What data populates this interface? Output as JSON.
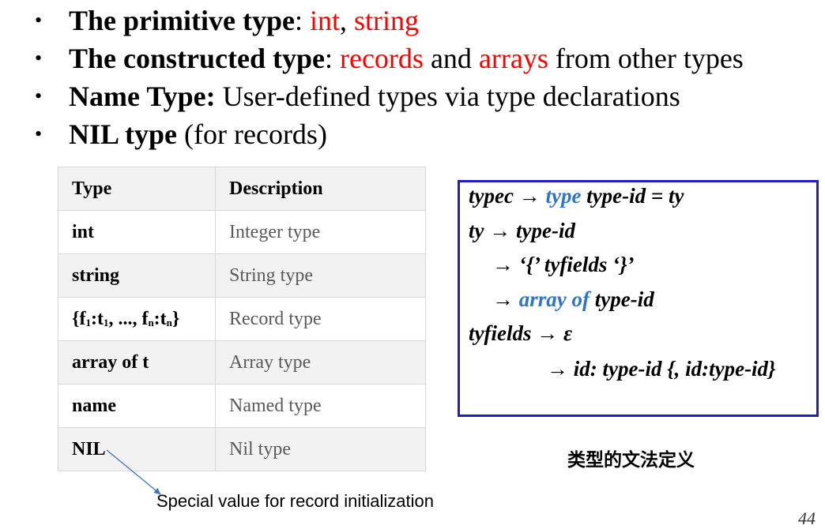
{
  "bullets": [
    {
      "bold": "The primitive type",
      "sep": ": ",
      "red1": "int",
      "mid": ", ",
      "red2": "string",
      "rest": ""
    },
    {
      "bold": "The constructed type",
      "sep": ": ",
      "red1": "records",
      "mid": " and ",
      "red2": "arrays",
      "rest": " from other types"
    },
    {
      "bold": "Name Type:",
      "rest": " User-defined types via type declarations"
    },
    {
      "bold": "NIL type",
      "rest": " (for records)"
    }
  ],
  "table": {
    "headers": [
      "Type",
      "Description"
    ],
    "rows": [
      {
        "type": "int",
        "desc": "Integer type"
      },
      {
        "type": "string",
        "desc": "String type"
      },
      {
        "type_parts": [
          "{f",
          "1",
          ":t",
          "1",
          ", ..., f",
          "n",
          ":t",
          "n",
          "}"
        ],
        "desc": "Record type"
      },
      {
        "type": "array of t",
        "desc": "Array type"
      },
      {
        "type": "name",
        "desc": "Named type"
      },
      {
        "type": "NIL",
        "desc": "Nil type"
      }
    ]
  },
  "grammar": {
    "l1": {
      "a": "typec → ",
      "kw": "type",
      "b": " type-id = ty"
    },
    "l2": "ty → type-id",
    "l3": "→ ‘{’ tyfields ‘}’",
    "l4": {
      "a": "→ ",
      "kw": "array of",
      "b": " type-id"
    },
    "l5": "tyfields → ε",
    "l6": "→ id: type-id {, id:type-id}",
    "caption": "类型的文法定义"
  },
  "note": "Special value for record initialization",
  "page_number": "44"
}
